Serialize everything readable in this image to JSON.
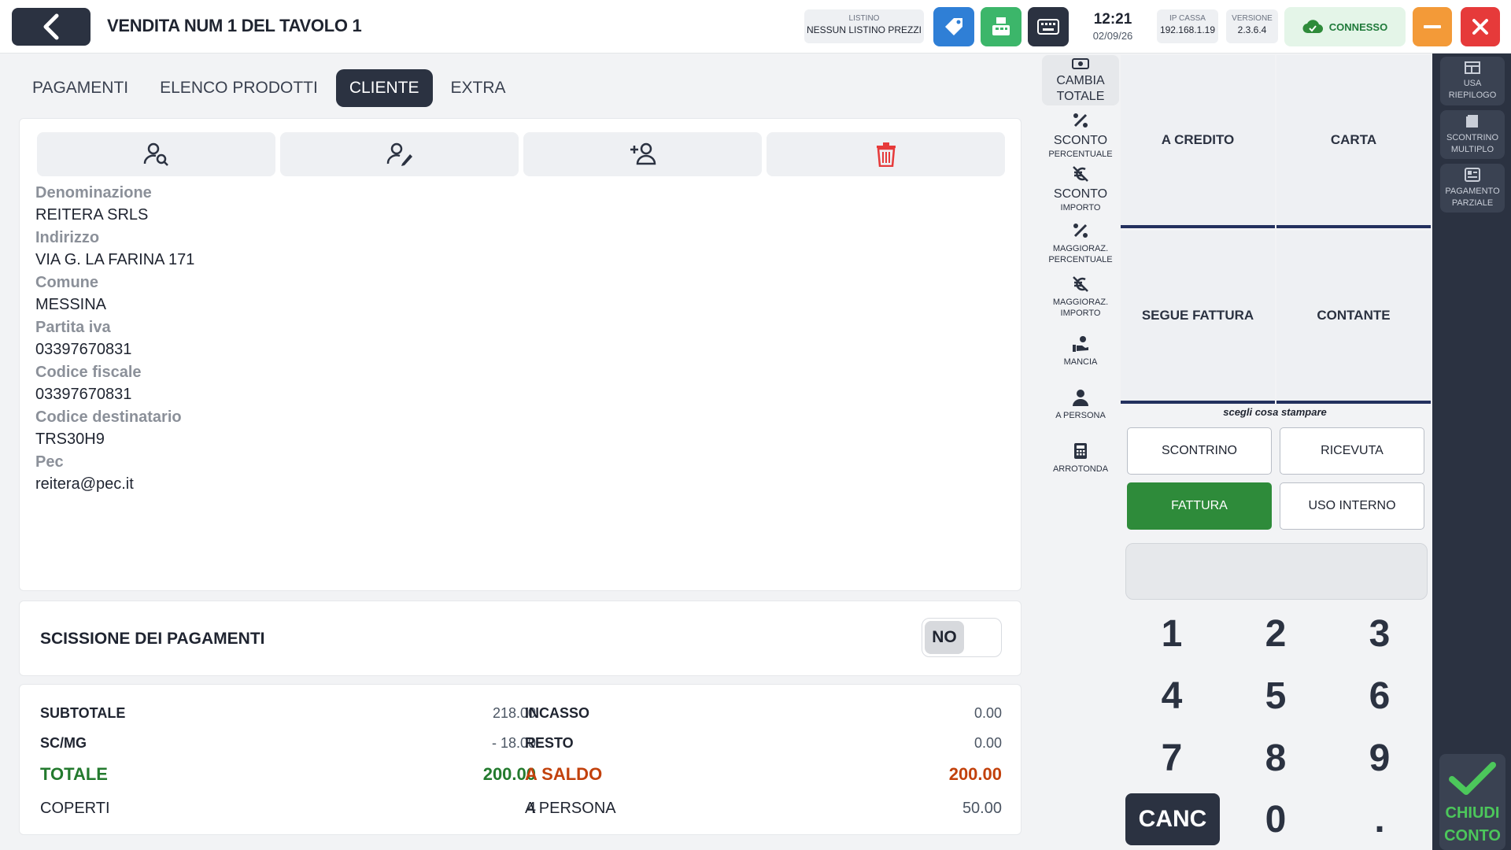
{
  "header": {
    "title": "VENDITA NUM 1 DEL TAVOLO 1",
    "listino_label": "LISTINO",
    "listino_value": "NESSUN LISTINO PREZZI",
    "time": "12:21",
    "date": "02/09/26",
    "ip_label": "IP CASSA",
    "ip_value": "192.168.1.19",
    "version_label": "VERSIONE",
    "version_value": "2.3.6.4",
    "status": "CONNESSO"
  },
  "tabs": [
    {
      "label": "PAGAMENTI"
    },
    {
      "label": "ELENCO PRODOTTI"
    },
    {
      "label": "CLIENTE"
    },
    {
      "label": "EXTRA"
    }
  ],
  "client": {
    "fields": [
      {
        "label": "Denominazione",
        "value": "REITERA SRLS"
      },
      {
        "label": "Indirizzo",
        "value": "VIA G. LA FARINA 171"
      },
      {
        "label": "Comune",
        "value": "MESSINA"
      },
      {
        "label": "Partita iva",
        "value": "03397670831"
      },
      {
        "label": "Codice fiscale",
        "value": "03397670831"
      },
      {
        "label": "Codice destinatario",
        "value": "TRS30H9"
      },
      {
        "label": "Pec",
        "value": "reitera@pec.it"
      }
    ]
  },
  "scissione": {
    "label": "SCISSIONE DEI PAGAMENTI",
    "value": "NO"
  },
  "totals": {
    "subtotale_label": "SUBTOTALE",
    "subtotale": "218.00",
    "scmg_label": "SC/MG",
    "scmg": "- 18.00",
    "totale_label": "TOTALE",
    "totale": "200.00",
    "coperti_label": "COPERTI",
    "coperti": "4",
    "incasso_label": "INCASSO",
    "incasso": "0.00",
    "resto_label": "RESTO",
    "resto": "0.00",
    "saldo_label": "A SALDO",
    "saldo": "200.00",
    "persona_label": "A PERSONA",
    "persona": "50.00"
  },
  "tools": [
    {
      "l1": "CAMBIA",
      "l2": "TOTALE"
    },
    {
      "l1": "SCONTO",
      "l2": "PERCENTUALE"
    },
    {
      "l1": "SCONTO",
      "l2": "IMPORTO"
    },
    {
      "l1": "MAGGIORAZ.",
      "l2": "PERCENTUALE"
    },
    {
      "l1": "MAGGIORAZ.",
      "l2": "IMPORTO"
    },
    {
      "l1": "MANCIA"
    },
    {
      "l1": "A PERSONA"
    },
    {
      "l1": "ARROTONDA"
    }
  ],
  "payments": [
    "A CREDITO",
    "CARTA",
    "SEGUE FATTURA",
    "CONTANTE"
  ],
  "print_hint": "scegli cosa stampare",
  "print_options": [
    "SCONTRINO",
    "RICEVUTA",
    "FATTURA",
    "USO INTERNO"
  ],
  "print_selected": "FATTURA",
  "keypad": [
    "1",
    "2",
    "3",
    "4",
    "5",
    "6",
    "7",
    "8",
    "9",
    "CANC",
    "0",
    "."
  ],
  "sidebar": [
    {
      "l1": "USA",
      "l2": "RIEPILOGO"
    },
    {
      "l1": "SCONTRINO",
      "l2": "MULTIPLO"
    },
    {
      "l1": "PAGAMENTO",
      "l2": "PARZIALE"
    }
  ],
  "close_account": {
    "l1": "CHIUDI",
    "l2": "CONTO"
  },
  "colors": {
    "dark": "#2b3241",
    "green": "#237a2e",
    "red": "#c2410c",
    "accent_blue": "#2f7fd6",
    "accent_green": "#3cb66a",
    "orange": "#f39a38",
    "danger": "#e63a3a"
  }
}
